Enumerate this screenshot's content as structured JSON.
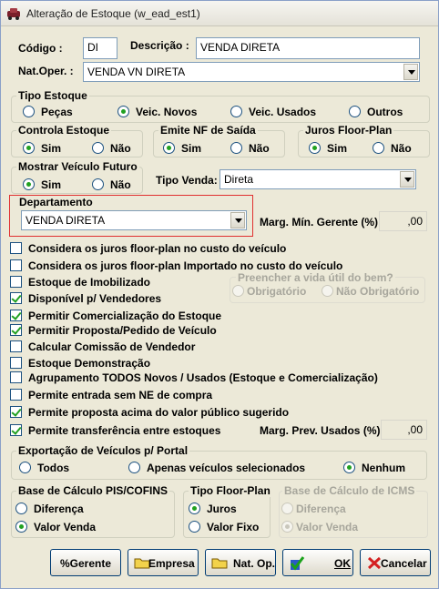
{
  "window": {
    "title": "Alteração de Estoque (w_ead_est1)"
  },
  "codigo": {
    "label": "Código :",
    "value": "DI"
  },
  "descricao": {
    "label": "Descrição :",
    "value": "VENDA DIRETA"
  },
  "natoper": {
    "label": "Nat.Oper. :",
    "value": "VENDA VN DIRETA"
  },
  "tipo_estoque": {
    "label": "Tipo Estoque",
    "options": [
      "Peças",
      "Veic. Novos",
      "Veic. Usados",
      "Outros"
    ],
    "selected": 1
  },
  "controla_estoque": {
    "label": "Controla Estoque",
    "sim": "Sim",
    "nao": "Não",
    "selected": "sim"
  },
  "emite_nf": {
    "label": "Emite NF de Saída",
    "sim": "Sim",
    "nao": "Não",
    "selected": "sim"
  },
  "juros_floor": {
    "label": "Juros Floor-Plan",
    "sim": "Sim",
    "nao": "Não",
    "selected": "sim"
  },
  "mostrar_futuro": {
    "label": "Mostrar Veículo Futuro",
    "sim": "Sim",
    "nao": "Não",
    "selected": "sim"
  },
  "tipo_venda": {
    "label": "Tipo Venda:",
    "value": "Direta"
  },
  "departamento": {
    "label": "Departamento",
    "value": "VENDA DIRETA"
  },
  "marg_min": {
    "label": "Marg. Mín. Gerente (%):",
    "value": ",00"
  },
  "vida_util": {
    "label": "Preencher a vida útil do bem?",
    "obrigatorio": "Obrigatório",
    "nao_obrigatorio": "Não Obrigatório"
  },
  "checks": [
    {
      "label": "Considera os juros floor-plan no custo do veículo",
      "checked": false
    },
    {
      "label": "Considera os juros floor-plan Importado no custo do veículo",
      "checked": false
    },
    {
      "label": "Estoque de Imobilizado",
      "checked": false
    },
    {
      "label": "Disponível p/ Vendedores",
      "checked": true
    },
    {
      "label": "Permitir Comercialização do Estoque",
      "checked": true
    },
    {
      "label": "Permitir Proposta/Pedido de Veículo",
      "checked": true
    },
    {
      "label": "Calcular Comissão de Vendedor",
      "checked": false
    },
    {
      "label": "Estoque Demonstração",
      "checked": false
    },
    {
      "label": "Agrupamento TODOS Novos / Usados (Estoque e Comercialização)",
      "checked": false
    },
    {
      "label": "Permite entrada sem NE de compra",
      "checked": false
    },
    {
      "label": "Permite proposta acima do valor público sugerido",
      "checked": true
    },
    {
      "label": "Permite transferência entre estoques",
      "checked": true
    }
  ],
  "marg_prev": {
    "label": "Marg. Prev. Usados (%):",
    "value": ",00"
  },
  "exportacao": {
    "label": "Exportação de Veículos p/ Portal",
    "todos": "Todos",
    "apenas": "Apenas veículos selecionados",
    "nenhum": "Nenhum",
    "selected": "nenhum"
  },
  "base_pis": {
    "label": "Base de Cálculo PIS/COFINS",
    "diferenca": "Diferença",
    "valor": "Valor Venda",
    "selected": "valor"
  },
  "tipo_floor": {
    "label": "Tipo Floor-Plan",
    "juros": "Juros",
    "valor_fixo": "Valor Fixo",
    "selected": "juros"
  },
  "base_icms": {
    "label": "Base de Cálculo de ICMS",
    "diferenca": "Diferença",
    "valor": "Valor Venda",
    "selected": "valor"
  },
  "buttons": {
    "gerente": "%Gerente",
    "empresa": "Empresa",
    "natop": "Nat. Op.",
    "ok": "OK",
    "cancelar": "Cancelar"
  },
  "colors": {
    "accent_green": "#21a121",
    "border_blue": "#7f9db9",
    "highlight_red": "#e03030"
  }
}
